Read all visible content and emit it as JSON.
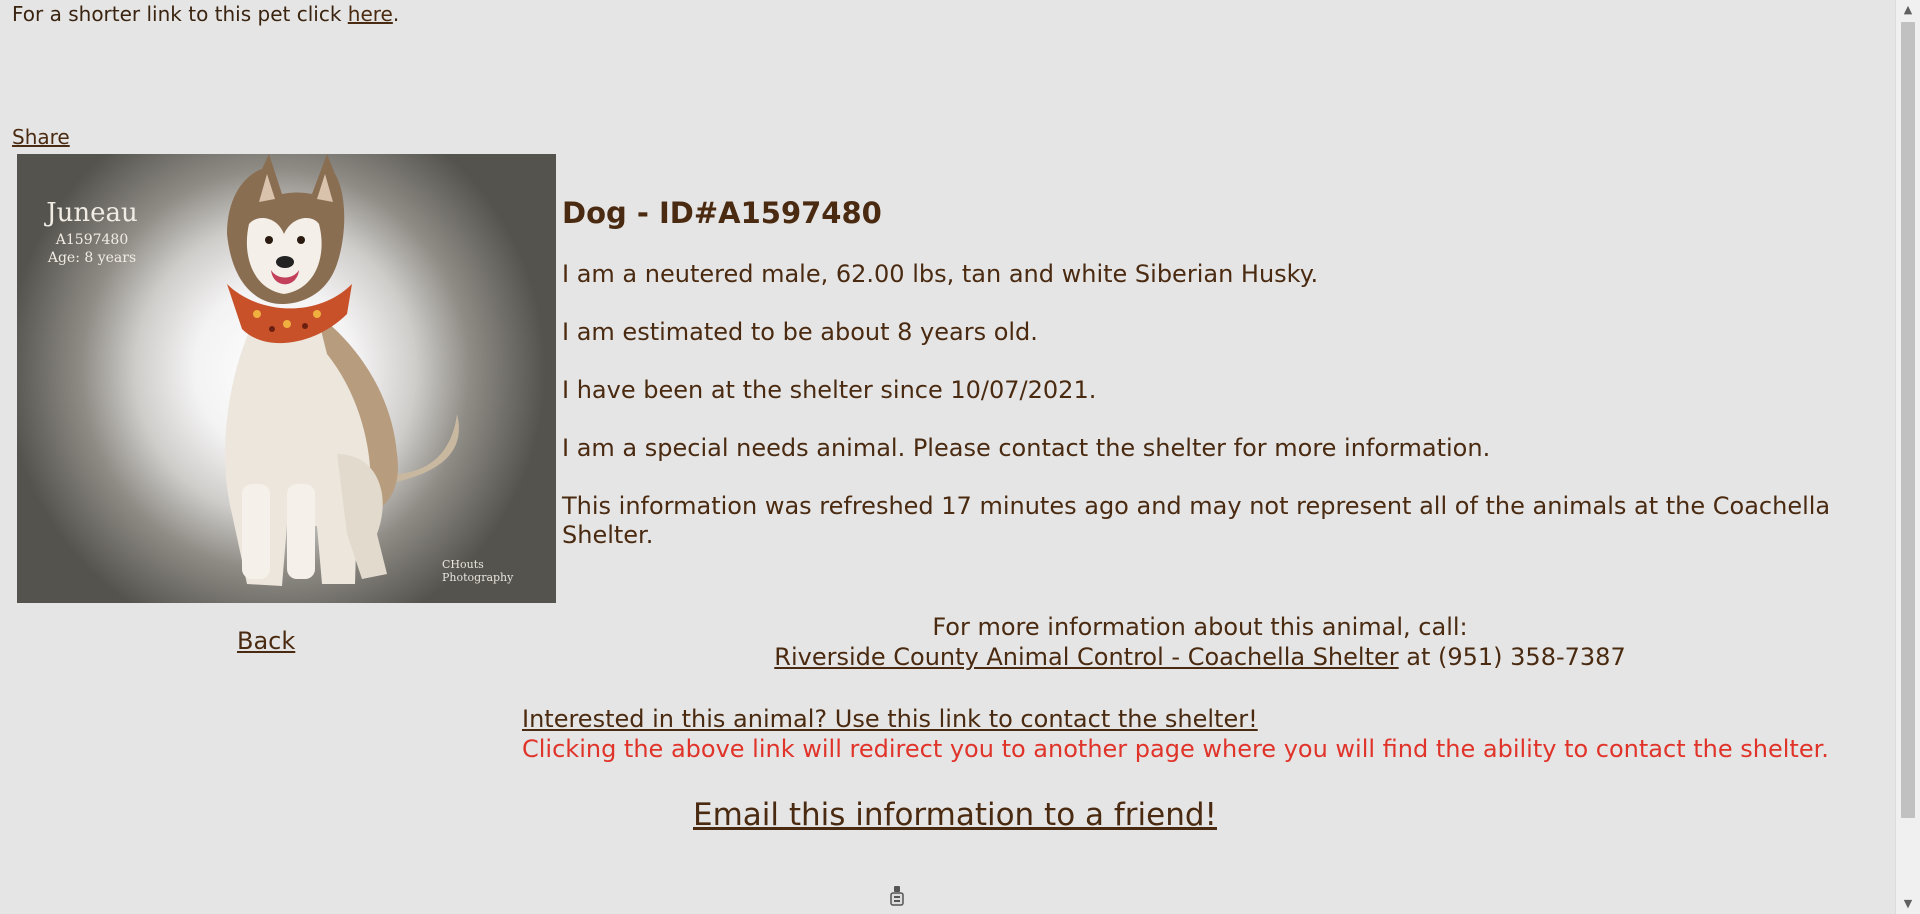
{
  "shortlink": {
    "prefix": "For a shorter link to this pet click ",
    "link_label": "here",
    "suffix": "."
  },
  "share_label": "Share",
  "photo": {
    "name": "Juneau",
    "id_text": "A1597480",
    "age_text": "Age: 8 years",
    "credit_line1": "CHouts",
    "credit_line2": "Photography"
  },
  "back_label": "Back",
  "animal": {
    "heading": "Dog - ID#A1597480",
    "lines": [
      "I am a neutered male, 62.00 lbs, tan and white Siberian Husky.",
      "I am estimated to be about 8 years old.",
      "I have been at the shelter since 10/07/2021.",
      "I am a special needs animal. Please contact the shelter for more information.",
      "This information was refreshed 17 minutes ago and may not represent all of the animals at the Coachella Shelter."
    ]
  },
  "contact": {
    "intro": "For more information about this animal, call:",
    "shelter_link": "Riverside County Animal Control - Coachella Shelter",
    "phone_text": " at (951) 358-7387"
  },
  "interest": {
    "link_label": "Interested in this animal? Use this link to contact the shelter!",
    "warning": "Clicking the above link will redirect you to another page where you will find the ability to contact the shelter."
  },
  "email_label": "Email this information to a friend!",
  "colors": {
    "background": "#e5e5e5",
    "text": "#4a2a10",
    "warning": "#e0342a"
  }
}
